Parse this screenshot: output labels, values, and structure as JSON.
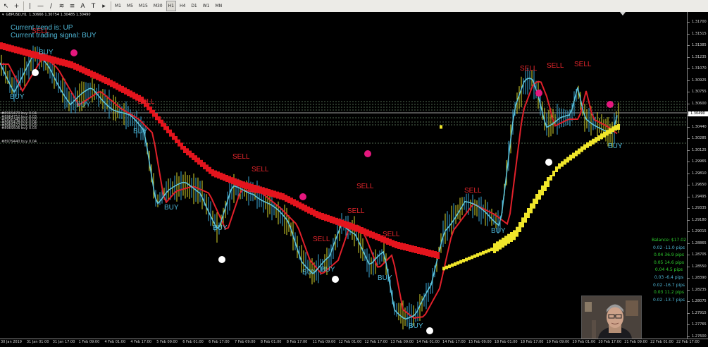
{
  "toolbar": {
    "timeframes": [
      "M1",
      "M5",
      "M15",
      "M30",
      "H1",
      "H4",
      "D1",
      "W1",
      "MN"
    ],
    "active_timeframe": "H1"
  },
  "chart": {
    "symbol_title": "GBPUSD,H1",
    "ohlc": "1.30666 1.30754 1.30485 1.30490",
    "trend_text": "Current trend is: UP",
    "signal_text": "Current trading signal: BUY",
    "order_labels": [
      "#8969470 buy 0.04",
      "#8964752 buy 0.03",
      "#8958340 buy 0.03",
      "#8969478 buy 0.04",
      "#8969472 buy 0.03",
      "#8969506 buy 0.03",
      "#8979440 buy 0.04"
    ],
    "sell_labels": [
      "SELL",
      "SELL",
      "SELL",
      "SELL",
      "SELL",
      "SELL",
      "SELL",
      "SELL",
      "SELL",
      "SELL",
      "SELL",
      "SELL"
    ],
    "buy_labels": [
      "BUY",
      "BUY",
      "BUY",
      "BUY",
      "BUY",
      "BUY",
      "BUY",
      "BUY",
      "BUY",
      "BUY",
      "BUY",
      "BUY"
    ],
    "colors": {
      "sell": "#e8262c",
      "buy": "#4fb7d6",
      "ribbon_down": "#e4141d",
      "ribbon_up": "#f0e62a",
      "dot_pink": "#e5177e",
      "dot_white": "#ffffff",
      "candle_up": "#d9d72b",
      "candle_down": "#3aa6d4"
    }
  },
  "price_axis": [
    "1.31700",
    "1.31515",
    "1.31385",
    "1.31235",
    "1.31070",
    "1.30925",
    "1.30755",
    "1.30600",
    "1.30490",
    "1.30440",
    "1.30285",
    "1.30125",
    "1.29965",
    "1.29810",
    "1.29650",
    "1.29495",
    "1.29335",
    "1.29180",
    "1.29015",
    "1.28865",
    "1.28705",
    "1.28550",
    "1.28390",
    "1.28235",
    "1.28075",
    "1.27915",
    "1.27765",
    "1.27600"
  ],
  "current_price": "1.30490",
  "time_axis": [
    "30 Jan 2019",
    "31 Jan 01:00",
    "31 Jan 17:00",
    "1 Feb 09:00",
    "4 Feb 01:00",
    "4 Feb 17:00",
    "5 Feb 09:00",
    "6 Feb 01:00",
    "6 Feb 17:00",
    "7 Feb 09:00",
    "8 Feb 01:00",
    "8 Feb 17:00",
    "11 Feb 09:00",
    "12 Feb 01:00",
    "12 Feb 17:00",
    "13 Feb 09:00",
    "14 Feb 01:00",
    "14 Feb 17:00",
    "15 Feb 09:00",
    "18 Feb 01:00",
    "18 Feb 17:00",
    "19 Feb 09:00",
    "20 Feb 01:00",
    "20 Feb 17:00",
    "21 Feb 09:00",
    "22 Feb 01:00",
    "22 Feb 17:00"
  ],
  "balance": {
    "title": "Balance: $17.02",
    "trades": [
      {
        "text": "0.02 -11.0 pips",
        "color": "#4fb7d6"
      },
      {
        "text": "0.04 36.9 pips",
        "color": "#2fd12f"
      },
      {
        "text": "0.05 14.6 pips",
        "color": "#2fd12f"
      },
      {
        "text": "0.04 4.5 pips",
        "color": "#2fd12f"
      },
      {
        "text": "0.03 -6.4 pips",
        "color": "#4fb7d6"
      },
      {
        "text": "0.02 -16.7 pips",
        "color": "#4fb7d6"
      },
      {
        "text": "0.03 11.2 pips",
        "color": "#2fd12f"
      },
      {
        "text": "0.02 -13.7 pips",
        "color": "#4fb7d6"
      }
    ],
    "title_color": "#2fd12f"
  }
}
